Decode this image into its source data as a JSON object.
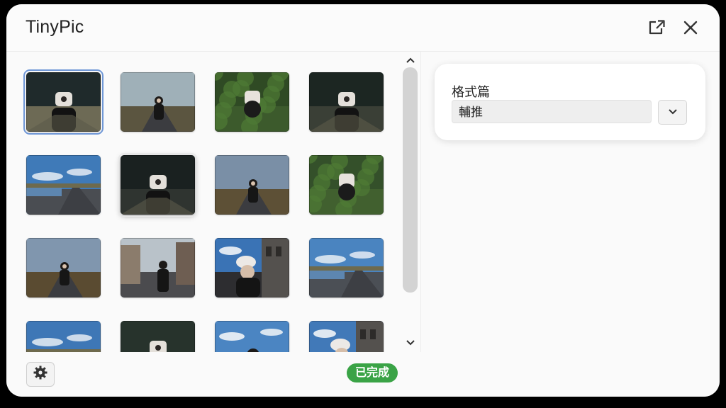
{
  "app": {
    "title": "TinyPic"
  },
  "titlebar": {
    "icons": [
      "share-export-icon",
      "close-icon"
    ]
  },
  "gallery": {
    "selected_index": 0,
    "thumbnails": [
      {
        "scene": "portrait-dark-green",
        "sky": "#1f2a2b",
        "ground": "#6d6a55"
      },
      {
        "scene": "road-field-portrait",
        "sky": "#9fb0b8",
        "ground": "#5b5540"
      },
      {
        "scene": "foliage-portrait",
        "sky": "#2f4a24",
        "ground": "#3c5a2c"
      },
      {
        "scene": "dark-portrait",
        "sky": "#1c2622",
        "ground": "#3a3f36"
      },
      {
        "scene": "lake-road",
        "sky": "#3f7ab8",
        "ground": "#4a4d52"
      },
      {
        "scene": "dark-portrait",
        "sky": "#1a2120",
        "ground": "#2f3430"
      },
      {
        "scene": "field-road-portrait",
        "sky": "#7a8fa6",
        "ground": "#5d5036"
      },
      {
        "scene": "foliage-portrait",
        "sky": "#34502a",
        "ground": "#41602f"
      },
      {
        "scene": "field-road-portrait",
        "sky": "#8096ae",
        "ground": "#5a4b31"
      },
      {
        "scene": "street-portrait",
        "sky": "#b9c2c9",
        "ground": "#4b4b4e"
      },
      {
        "scene": "building-portrait",
        "sky": "#3a73b5",
        "ground": "#2d2d30"
      },
      {
        "scene": "lake-road",
        "sky": "#4a84c0",
        "ground": "#4b4f55"
      },
      {
        "scene": "lake-road",
        "sky": "#3e77b6",
        "ground": "#505055"
      },
      {
        "scene": "dark-portrait",
        "sky": "#27332c",
        "ground": "#3a3f36"
      },
      {
        "scene": "sky-portrait",
        "sky": "#4b85c2",
        "ground": "#2d2a28"
      },
      {
        "scene": "building-portrait",
        "sky": "#4179b8",
        "ground": "#302c2a"
      }
    ]
  },
  "footer": {
    "settings_icon": "gear-icon",
    "status": "已完成",
    "status_color": "#3aa346"
  },
  "format_panel": {
    "label": "格式篇",
    "selected_value": "輔推",
    "dropdown_icon": "chevron-down-icon"
  }
}
